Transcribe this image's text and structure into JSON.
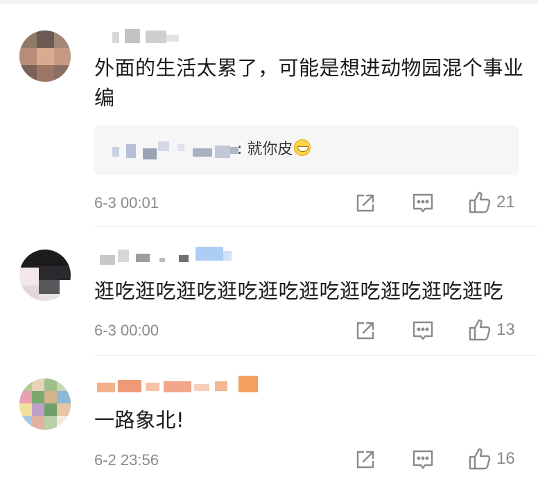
{
  "comments": [
    {
      "text": "外面的生活太累了，可能是想进动物园混个事业编",
      "reply": {
        "text": ": 就你皮",
        "emoji": "grinning-emoji"
      },
      "time": "6-3 00:01",
      "likes": "21"
    },
    {
      "text": "逛吃逛吃逛吃逛吃逛吃逛吃逛吃逛吃逛吃逛吃",
      "time": "6-3 00:00",
      "likes": "13"
    },
    {
      "text": "一路象北!",
      "time": "6-2 23:56",
      "likes": "16"
    }
  ],
  "icons": {
    "share": "share-icon",
    "comment": "comment-icon",
    "like": "thumbs-up-icon"
  },
  "colors": {
    "meta_gray": "#8a8a8a",
    "reply_bg": "#f6f6f6"
  }
}
